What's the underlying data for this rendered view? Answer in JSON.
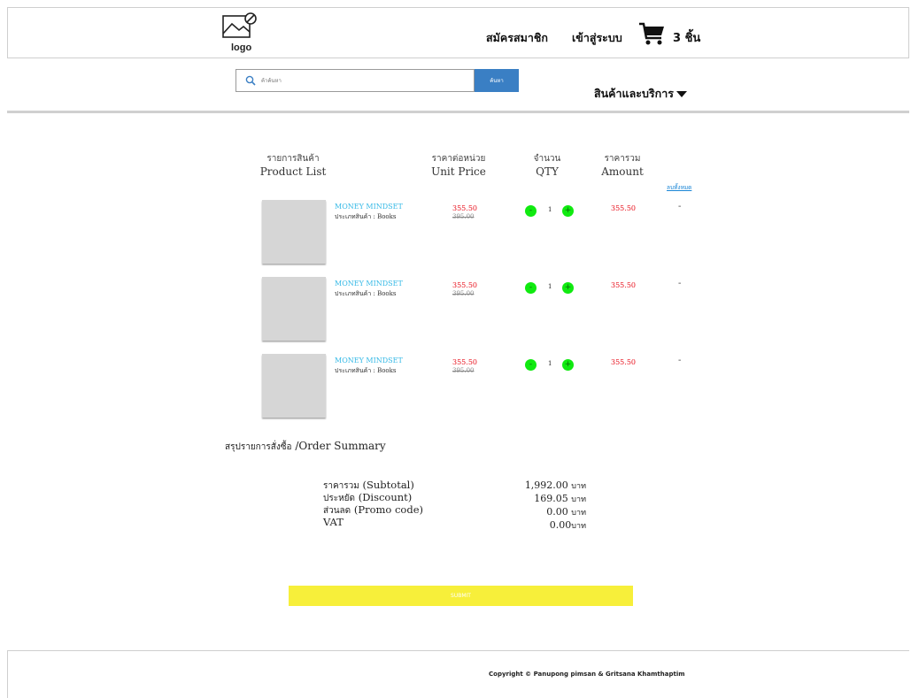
{
  "header": {
    "logo_text": "logo",
    "register": "สมัครสมาชิก",
    "login": "เข้าสู่ระบบ",
    "cart_count": "3 ชิ้น"
  },
  "search": {
    "placeholder": "ค้าค้นหา",
    "button": "ค้นหา"
  },
  "menu": {
    "products_services": "สินค้าและบริการ"
  },
  "table": {
    "headers": {
      "product_th": "รายการสินค้า",
      "product_en": "Product List",
      "unit_th": "ราคาต่อหน่วย",
      "unit_en": "Unit Price",
      "qty_th": "จำนวน",
      "qty_en": "QTY",
      "amount_th": "ราคารวม",
      "amount_en": "Amount"
    },
    "clear_all": "ลบทั้งหมด",
    "rows": [
      {
        "name": "MONEY MINDSET",
        "category": "ประเภทสินค้า : Books",
        "price": "355.50",
        "old_price": "395.00",
        "qty": "1",
        "amount": "355.50",
        "remove": "-"
      },
      {
        "name": "MONEY MINDSET",
        "category": "ประเภทสินค้า : Books",
        "price": "355.50",
        "old_price": "395.00",
        "qty": "1",
        "amount": "355.50",
        "remove": "-"
      },
      {
        "name": "MONEY MINDSET",
        "category": "ประเภทสินค้า : Books",
        "price": "355.50",
        "old_price": "395.00",
        "qty": "1",
        "amount": "355.50",
        "remove": "-"
      }
    ],
    "qty_minus": "-",
    "qty_plus": "+"
  },
  "summary": {
    "title_th": "สรุปรายการสั่งซื้อ",
    "title_en": " /Order Summary",
    "subtotal_th": "ราคารวม",
    "subtotal_en": " (Subtotal)",
    "discount_th": "ประหยัด",
    "discount_en": " (Discount)",
    "promo_th": "ส่วนลด",
    "promo_en": " (Promo code)",
    "vat": "VAT",
    "subtotal_value": "1,992.00",
    "discount_value": "169.05",
    "promo_value": "0.00",
    "vat_value": "0.00",
    "unit": "บาท",
    "unit_sep": " "
  },
  "submit": "SUBMIT",
  "footer": {
    "copyright": "Copyright © Panupong pimsan &  Gritsana Khamthaptim"
  },
  "colors": {
    "search_button": "#3a7fc4",
    "product_name": "#35b9e6",
    "price": "#e8101c",
    "qty_button": "#10ea10",
    "submit_button": "#f7ef3a"
  }
}
